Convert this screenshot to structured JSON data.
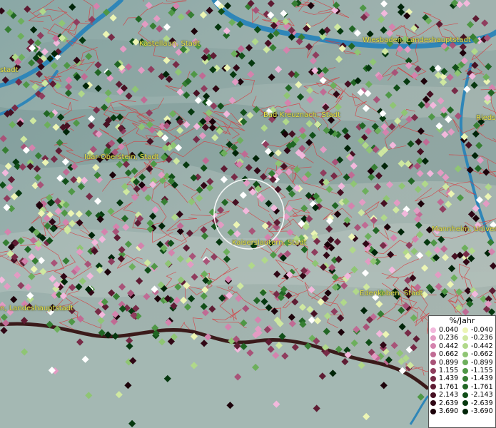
{
  "cities": [
    {
      "label": "Kastellaun, Stadt"
    },
    {
      "label": "Wiesbaden, Landeshauptstadt"
    },
    {
      "label": "stadt"
    },
    {
      "label": "Bad Kreuznach, Stadt"
    },
    {
      "label": "Rieds"
    },
    {
      "label": "Idar-Oberstein, Stadt"
    },
    {
      "label": "Kaiserslautern, Stadt"
    },
    {
      "label": "Mannheim, Univer"
    },
    {
      "label": "Edenkoben, Stadt"
    },
    {
      "label": "n, Landeshauptstadt"
    }
  ],
  "legend": {
    "title": "%/Jahr",
    "positive": [
      {
        "value": "0.040",
        "color": "#f2b8dc"
      },
      {
        "value": "0.236",
        "color": "#e39bc3"
      },
      {
        "value": "0.442",
        "color": "#d483ad"
      },
      {
        "value": "0.662",
        "color": "#c06b94"
      },
      {
        "value": "0.899",
        "color": "#a85378"
      },
      {
        "value": "1.155",
        "color": "#8f3d5e"
      },
      {
        "value": "1.439",
        "color": "#772b47"
      },
      {
        "value": "1.761",
        "color": "#5e1c33"
      },
      {
        "value": "2.143",
        "color": "#461022"
      },
      {
        "value": "2.639",
        "color": "#300715"
      },
      {
        "value": "3.690",
        "color": "#1c020a"
      }
    ],
    "negative": [
      {
        "value": "-0.040",
        "color": "#ecf5b4"
      },
      {
        "value": "-0.236",
        "color": "#cfe8a0"
      },
      {
        "value": "-0.442",
        "color": "#b0d88a"
      },
      {
        "value": "-0.662",
        "color": "#8fc574"
      },
      {
        "value": "-0.899",
        "color": "#6daf5c"
      },
      {
        "value": "-1.155",
        "color": "#4f9746"
      },
      {
        "value": "-1.439",
        "color": "#367e33"
      },
      {
        "value": "-1.761",
        "color": "#216624"
      },
      {
        "value": "-2.143",
        "color": "#114e18"
      },
      {
        "value": "-2.639",
        "color": "#06380f"
      },
      {
        "value": "-3.690",
        "color": "#002408"
      }
    ]
  }
}
